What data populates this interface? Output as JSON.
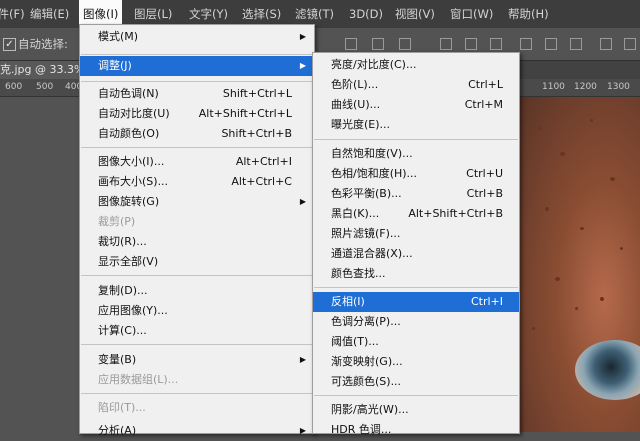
{
  "menubar": {
    "items": [
      {
        "label": "文件(F)"
      },
      {
        "label": "编辑(E)"
      },
      {
        "label": "图像(I)"
      },
      {
        "label": "图层(L)"
      },
      {
        "label": "文字(Y)"
      },
      {
        "label": "选择(S)"
      },
      {
        "label": "滤镜(T)"
      },
      {
        "label": "3D(D)"
      },
      {
        "label": "视图(V)"
      },
      {
        "label": "窗口(W)"
      },
      {
        "label": "帮助(H)"
      }
    ]
  },
  "options": {
    "auto_select_label": "自动选择:",
    "checkbox_mark": "✓"
  },
  "document": {
    "tab_label": "克.jpg @ 33.3%"
  },
  "ruler": {
    "left_labels": [
      "600",
      "500",
      "400"
    ],
    "right_labels": [
      "1100",
      "1200",
      "1300"
    ]
  },
  "image_menu": {
    "items": [
      {
        "label": "模式(M)",
        "shortcut": ""
      },
      {
        "label": "调整(J)",
        "shortcut": ""
      },
      {
        "label": "自动色调(N)",
        "shortcut": "Shift+Ctrl+L"
      },
      {
        "label": "自动对比度(U)",
        "shortcut": "Alt+Shift+Ctrl+L"
      },
      {
        "label": "自动颜色(O)",
        "shortcut": "Shift+Ctrl+B"
      },
      {
        "label": "图像大小(I)...",
        "shortcut": "Alt+Ctrl+I"
      },
      {
        "label": "画布大小(S)...",
        "shortcut": "Alt+Ctrl+C"
      },
      {
        "label": "图像旋转(G)",
        "shortcut": ""
      },
      {
        "label": "裁剪(P)",
        "shortcut": ""
      },
      {
        "label": "裁切(R)...",
        "shortcut": ""
      },
      {
        "label": "显示全部(V)",
        "shortcut": ""
      },
      {
        "label": "复制(D)...",
        "shortcut": ""
      },
      {
        "label": "应用图像(Y)...",
        "shortcut": ""
      },
      {
        "label": "计算(C)...",
        "shortcut": ""
      },
      {
        "label": "变量(B)",
        "shortcut": ""
      },
      {
        "label": "应用数据组(L)...",
        "shortcut": ""
      },
      {
        "label": "陷印(T)...",
        "shortcut": ""
      },
      {
        "label": "分析(A)",
        "shortcut": ""
      }
    ]
  },
  "adjust_menu": {
    "items": [
      {
        "label": "亮度/对比度(C)...",
        "shortcut": ""
      },
      {
        "label": "色阶(L)...",
        "shortcut": "Ctrl+L"
      },
      {
        "label": "曲线(U)...",
        "shortcut": "Ctrl+M"
      },
      {
        "label": "曝光度(E)...",
        "shortcut": ""
      },
      {
        "label": "自然饱和度(V)...",
        "shortcut": ""
      },
      {
        "label": "色相/饱和度(H)...",
        "shortcut": "Ctrl+U"
      },
      {
        "label": "色彩平衡(B)...",
        "shortcut": "Ctrl+B"
      },
      {
        "label": "黑白(K)...",
        "shortcut": "Alt+Shift+Ctrl+B"
      },
      {
        "label": "照片滤镜(F)...",
        "shortcut": ""
      },
      {
        "label": "通道混合器(X)...",
        "shortcut": ""
      },
      {
        "label": "颜色查找...",
        "shortcut": ""
      },
      {
        "label": "反相(I)",
        "shortcut": "Ctrl+I"
      },
      {
        "label": "色调分离(P)...",
        "shortcut": ""
      },
      {
        "label": "阈值(T)...",
        "shortcut": ""
      },
      {
        "label": "渐变映射(G)...",
        "shortcut": ""
      },
      {
        "label": "可选颜色(S)...",
        "shortcut": ""
      },
      {
        "label": "阴影/高光(W)...",
        "shortcut": ""
      },
      {
        "label": "HDR 色调...",
        "shortcut": ""
      }
    ]
  },
  "icons": {
    "submenu_arrow": "▶"
  },
  "colors": {
    "highlight": "#1e6ed5",
    "menubar_bg": "#3d3d3d",
    "menu_bg": "#f0f0f0"
  }
}
